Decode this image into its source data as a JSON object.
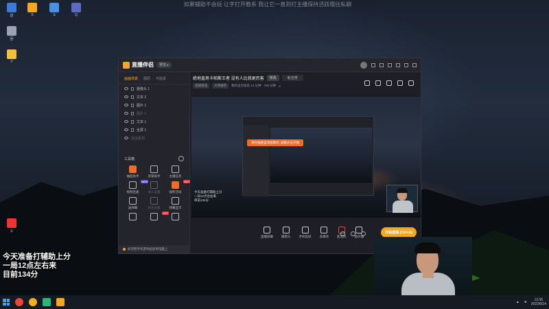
{
  "stream_title": "如果辅助不会玩 让字打开教系 我让它一直到打主播保持活跃哦往私聊",
  "desktop_icons": [
    {
      "label": "应",
      "color": "#3a7bd5"
    },
    {
      "label": "S",
      "color": "#f5a623"
    },
    {
      "label": "S",
      "color": "#4a90e2"
    },
    {
      "label": "Q",
      "color": "#5c6bc0"
    },
    {
      "label": "回",
      "color": "#9aa4b0"
    },
    {
      "label": "V",
      "color": "#f0c040"
    },
    {
      "label": "斗",
      "color": "#e33"
    }
  ],
  "overlay_text": [
    "今天准备打辅助上分",
    "一局12点左右来",
    "目前134分"
  ],
  "app": {
    "name": "直播伴侣",
    "version": "预览 ▸",
    "left_tabs": [
      "画面场景",
      "图层",
      "可能素"
    ],
    "scenes": [
      {
        "label": "摄像头 1",
        "dim": false
      },
      {
        "label": "文本 2",
        "dim": false
      },
      {
        "label": "图片 1",
        "dim": false
      },
      {
        "label": "图片 2",
        "dim": true
      },
      {
        "label": "文本 1",
        "dim": false
      },
      {
        "label": "全屏 1",
        "dim": false
      },
      {
        "label": "添加素材",
        "dim": true
      }
    ],
    "tools_title": "工具箱",
    "tools": [
      {
        "label": "抽屉助手",
        "highlight": true,
        "badge": ""
      },
      {
        "label": "房管助手",
        "highlight": false,
        "badge": ""
      },
      {
        "label": "主播任务",
        "highlight": false,
        "badge": ""
      },
      {
        "label": "视频连麦",
        "highlight": false,
        "badge": "NEW"
      },
      {
        "label": "录入设置",
        "highlight": false,
        "badge": "",
        "dim": true
      },
      {
        "label": "福利活动",
        "highlight": true,
        "badge": "HOT"
      },
      {
        "label": "送弹幕",
        "highlight": false,
        "badge": ""
      },
      {
        "label": "批注设备",
        "highlight": false,
        "badge": "",
        "dim": true
      },
      {
        "label": "弹幕显示",
        "highlight": false,
        "badge": ""
      },
      {
        "label": "",
        "highlight": false,
        "badge": ""
      },
      {
        "label": "",
        "highlight": false,
        "badge": "HOT"
      },
      {
        "label": "",
        "highlight": false,
        "badge": ""
      }
    ],
    "notice": "如何把手机游戏投屏到电脑上",
    "room": {
      "title": "绝地直男卡帕斯王者 没有人比我更厉害",
      "tag": "修改",
      "category": "射击类",
      "meta": [
        "直播管理",
        "大神推荐",
        "我的主页排名 10 分钟",
        "799 分钟",
        "4"
      ]
    },
    "preview_tip": "请在抽屉里添加素材, 提醒点击开播",
    "preview_caption": [
      "今天准备打辅助上分",
      "一局12点左右来",
      "目前134分"
    ],
    "bottom_toolbar": [
      {
        "label": "直播屏幕",
        "red": false
      },
      {
        "label": "摄像头",
        "red": false
      },
      {
        "label": "手机投屏",
        "red": false
      },
      {
        "label": "多媒体",
        "red": false
      },
      {
        "label": "麦克风",
        "red": true
      },
      {
        "label": "扬声器",
        "red": false
      }
    ],
    "start_button": "开始直播 (Ctrl+A)"
  },
  "taskbar": {
    "time": "12:35",
    "date": "2022/6/14"
  }
}
